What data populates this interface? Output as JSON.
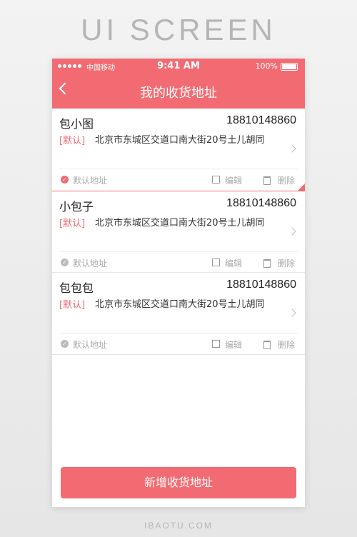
{
  "heading": "UI SCREEN",
  "status_bar": {
    "carrier": "中国移动",
    "time": "9:41 AM",
    "battery": "100%"
  },
  "nav": {
    "title": "我的收货地址"
  },
  "addresses": [
    {
      "name": "包小图",
      "phone": "18810148860",
      "tag": "[默认]",
      "address": "北京市东城区交道口南大街20号土儿胡同",
      "default_label": "默认地址",
      "edit_label": "编辑",
      "delete_label": "删除"
    },
    {
      "name": "小包子",
      "phone": "18810148860",
      "tag": "[默认]",
      "address": "北京市东城区交道口南大街20号土儿胡同",
      "default_label": "默认地址",
      "edit_label": "编辑",
      "delete_label": "删除"
    },
    {
      "name": "包包包",
      "phone": "18810148860",
      "tag": "[默认]",
      "address": "北京市东城区交道口南大街20号土儿胡同",
      "default_label": "默认地址",
      "edit_label": "编辑",
      "delete_label": "删除"
    }
  ],
  "add_button": "新增收货地址",
  "footer": "IBAOTU.COM",
  "colors": {
    "accent": "#f36b72"
  }
}
